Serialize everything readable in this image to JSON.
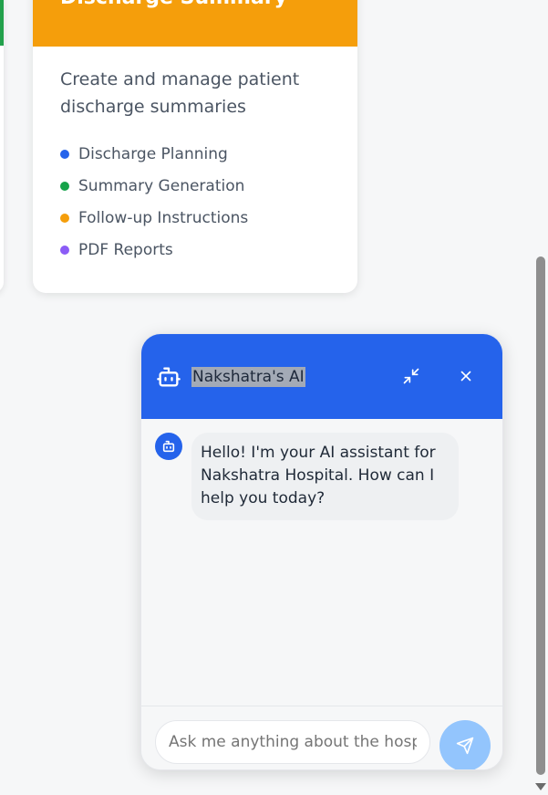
{
  "card": {
    "title": "Discharge Summary",
    "description": "Create and manage patient discharge summaries",
    "header_color": "#f59e0b",
    "features": [
      {
        "label": "Discharge Planning",
        "color": "#2563eb"
      },
      {
        "label": "Summary Generation",
        "color": "#16a34a"
      },
      {
        "label": "Follow-up Instructions",
        "color": "#f59e0b"
      },
      {
        "label": "PDF Reports",
        "color": "#8b5cf6"
      }
    ]
  },
  "chat": {
    "title": "Nakshatra's AI",
    "accent": "#2563eb",
    "header_icon": "robot-icon",
    "minimize_icon": "minimize-icon",
    "close_icon": "close-icon",
    "messages": [
      {
        "sender": "bot",
        "text": "Hello! I'm your AI assistant for Nakshatra Hospital. How can I help you today?"
      }
    ],
    "input": {
      "placeholder": "Ask me anything about the hospital...",
      "value": ""
    },
    "send_icon": "send-icon"
  }
}
